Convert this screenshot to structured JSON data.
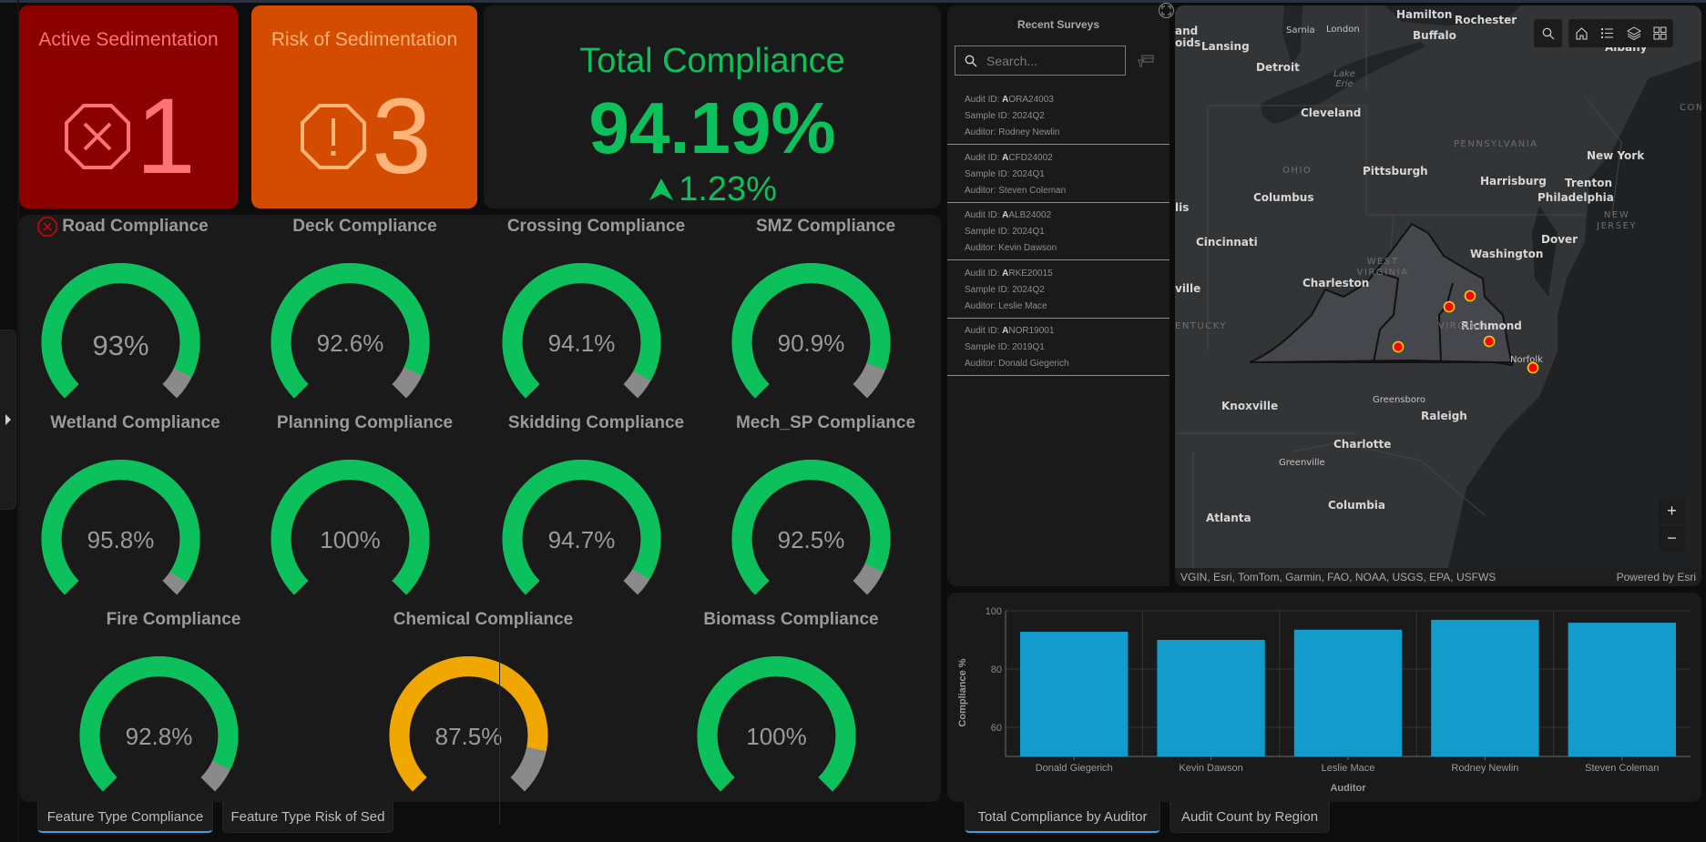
{
  "indicators": {
    "active": {
      "title": "Active Sedimentation",
      "value": "1",
      "icon": "octagon-x-icon",
      "bg": "#8b0000",
      "fg": "#ff7276"
    },
    "risk": {
      "title": "Risk of Sedimentation",
      "value": "3",
      "icon": "octagon-exclamation-icon",
      "bg": "#d44c00",
      "fg": "#ffb47a"
    },
    "total": {
      "title": "Total Compliance",
      "value": "94.19%",
      "delta": "1.23%",
      "delta_icon": "arrow-up-icon",
      "color": "#0cc05c"
    }
  },
  "gauges": [
    {
      "title": "Road Compliance",
      "value": 93,
      "label": "93%",
      "color": "#0cc05c",
      "alert_icon": "octagon-x-icon"
    },
    {
      "title": "Deck Compliance",
      "value": 92.6,
      "label": "92.6%",
      "color": "#0cc05c"
    },
    {
      "title": "Crossing Compliance",
      "value": 94.1,
      "label": "94.1%",
      "color": "#0cc05c"
    },
    {
      "title": "SMZ Compliance",
      "value": 90.9,
      "label": "90.9%",
      "color": "#0cc05c"
    },
    {
      "title": "Wetland Compliance",
      "value": 95.8,
      "label": "95.8%",
      "color": "#0cc05c"
    },
    {
      "title": "Planning Compliance",
      "value": 100,
      "label": "100%",
      "color": "#0cc05c"
    },
    {
      "title": "Skidding Compliance",
      "value": 94.7,
      "label": "94.7%",
      "color": "#0cc05c"
    },
    {
      "title": "Mech_SP Compliance",
      "value": 92.5,
      "label": "92.5%",
      "color": "#0cc05c"
    },
    {
      "title": "Fire Compliance",
      "value": 92.8,
      "label": "92.8%",
      "color": "#0cc05c"
    },
    {
      "title": "Chemical Compliance",
      "value": 87.5,
      "label": "87.5%",
      "color": "#f0a800"
    },
    {
      "title": "Biomass Compliance",
      "value": 100,
      "label": "100%",
      "color": "#0cc05c"
    }
  ],
  "left_tabs": [
    {
      "label": "Feature Type Compliance",
      "active": true
    },
    {
      "label": "Feature Type Risk of Sed",
      "active": false
    }
  ],
  "surveys": {
    "title": "Recent Surveys",
    "search_placeholder": "Search...",
    "labels": {
      "audit": "Audit ID: ",
      "sample": "Sample ID: ",
      "auditor": "Auditor: "
    },
    "items": [
      {
        "audit_prefix": "A",
        "audit_rest": "ORA24003",
        "sample": "2024Q2",
        "auditor": "Rodney Newlin"
      },
      {
        "audit_prefix": "A",
        "audit_rest": "CFD24002",
        "sample": "2024Q1",
        "auditor": "Steven Coleman"
      },
      {
        "audit_prefix": "A",
        "audit_rest": "ALB24002",
        "sample": "2024Q1",
        "auditor": "Kevin Dawson"
      },
      {
        "audit_prefix": "A",
        "audit_rest": "RKE20015",
        "sample": "2024Q2",
        "auditor": "Leslie Mace"
      },
      {
        "audit_prefix": "A",
        "audit_rest": "NOR19001",
        "sample": "2019Q1",
        "auditor": "Donald Giegerich"
      }
    ]
  },
  "map": {
    "cities": [
      "Hamilton",
      "Rochester",
      "Sarnia",
      "London",
      "Buffalo",
      "Lansing",
      "Detroit",
      "Cleveland",
      "Pittsburgh",
      "Columbus",
      "Harrisburg",
      "New York",
      "Trenton",
      "Philadelphia",
      "Dover",
      "Washington",
      "Cincinnati",
      "Charleston",
      "Richmond",
      "Norfolk",
      "Knoxville",
      "Greensboro",
      "Raleigh",
      "Charlotte",
      "Greenville",
      "Columbia",
      "Atlanta",
      "Albany",
      "and",
      "oids",
      "lis",
      "ville"
    ],
    "regions": [
      "PENNSYLVANIA",
      "OHIO",
      "WEST VIRGINIA",
      "VIRGINIA",
      "NEW JERSEY",
      "ENTUCKY",
      "CON"
    ],
    "lake": "Lake Erie",
    "attribution": "VGIN, Esri, TomTom, Garmin, FAO, NOAA, USGS, EPA, USFWS",
    "powered_by": "Powered by Esri",
    "zoom_in": "+",
    "zoom_out": "−"
  },
  "right_tabs": [
    {
      "label": "Total Compliance by Auditor",
      "active": true
    },
    {
      "label": "Audit Count by Region",
      "active": false
    }
  ],
  "chart_data": {
    "type": "bar",
    "title": "",
    "categories": [
      "Donald Giegerich",
      "Kevin Dawson",
      "Leslie Mace",
      "Rodney Newlin",
      "Steven Coleman"
    ],
    "values": [
      92.8,
      90.0,
      93.5,
      96.9,
      95.9
    ],
    "xlabel": "Auditor",
    "ylabel": "Compliance %",
    "ylim": [
      50,
      100
    ],
    "yticks": [
      60,
      80,
      100
    ],
    "grid": true,
    "bar_color": "#139bcc"
  }
}
